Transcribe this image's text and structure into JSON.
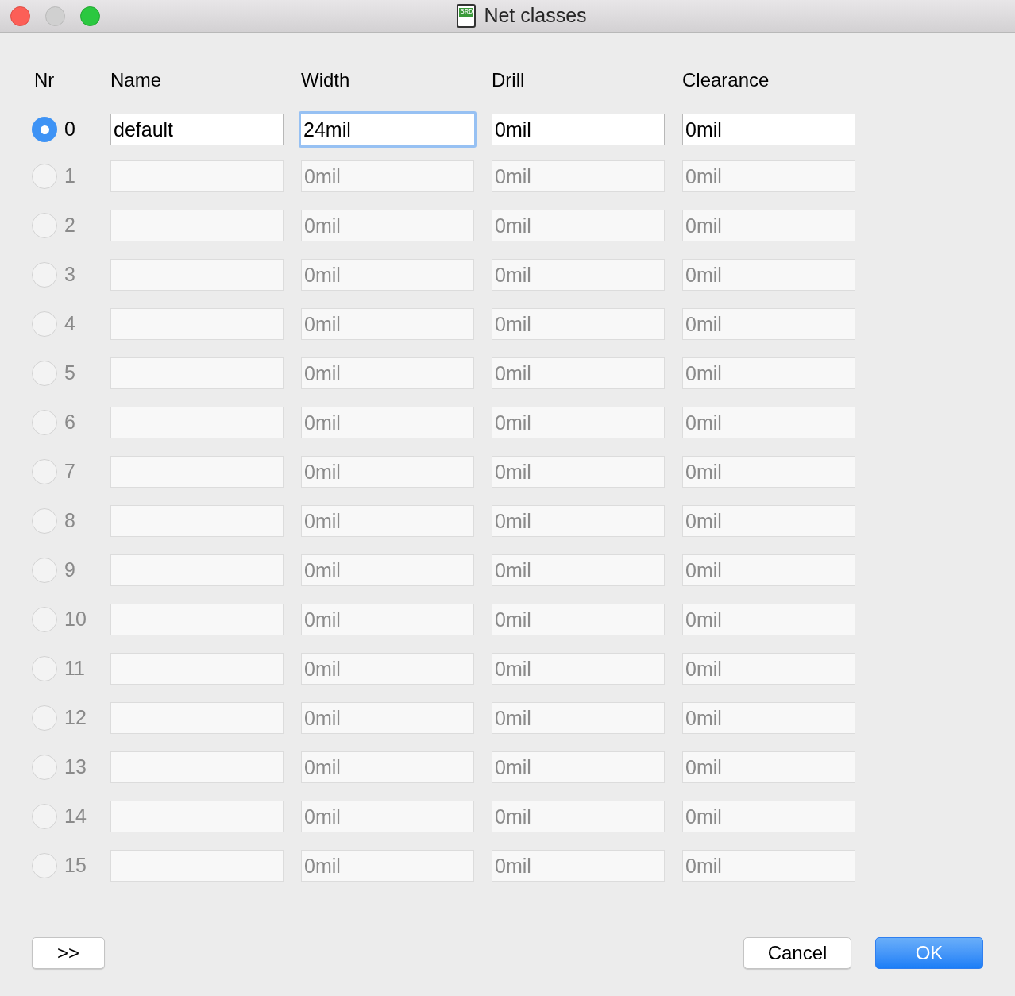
{
  "window": {
    "title": "Net classes",
    "icon_label": "BRD"
  },
  "columns": [
    "Nr",
    "Name",
    "Width",
    "Drill",
    "Clearance"
  ],
  "rows": [
    {
      "nr": "0",
      "selected": true,
      "disabled": false,
      "fields": [
        {
          "value": "default",
          "focused": false
        },
        {
          "value": "24mil",
          "focused": true
        },
        {
          "value": "0mil",
          "focused": false
        },
        {
          "value": "0mil",
          "focused": false
        }
      ]
    },
    {
      "nr": "1",
      "selected": false,
      "disabled": true,
      "fields": [
        {
          "focused": false
        },
        {
          "value": "0mil",
          "focused": false
        },
        {
          "value": "0mil",
          "focused": false
        },
        {
          "value": "0mil",
          "focused": false
        }
      ]
    },
    {
      "nr": "2",
      "selected": false,
      "disabled": true,
      "fields": [
        {
          "focused": false
        },
        {
          "value": "0mil",
          "focused": false
        },
        {
          "value": "0mil",
          "focused": false
        },
        {
          "value": "0mil",
          "focused": false
        }
      ]
    },
    {
      "nr": "3",
      "selected": false,
      "disabled": true,
      "fields": [
        {
          "focused": false
        },
        {
          "value": "0mil",
          "focused": false
        },
        {
          "value": "0mil",
          "focused": false
        },
        {
          "value": "0mil",
          "focused": false
        }
      ]
    },
    {
      "nr": "4",
      "selected": false,
      "disabled": true,
      "fields": [
        {
          "focused": false
        },
        {
          "value": "0mil",
          "focused": false
        },
        {
          "value": "0mil",
          "focused": false
        },
        {
          "value": "0mil",
          "focused": false
        }
      ]
    },
    {
      "nr": "5",
      "selected": false,
      "disabled": true,
      "fields": [
        {
          "focused": false
        },
        {
          "value": "0mil",
          "focused": false
        },
        {
          "value": "0mil",
          "focused": false
        },
        {
          "value": "0mil",
          "focused": false
        }
      ]
    },
    {
      "nr": "6",
      "selected": false,
      "disabled": true,
      "fields": [
        {
          "focused": false
        },
        {
          "value": "0mil",
          "focused": false
        },
        {
          "value": "0mil",
          "focused": false
        },
        {
          "value": "0mil",
          "focused": false
        }
      ]
    },
    {
      "nr": "7",
      "selected": false,
      "disabled": true,
      "fields": [
        {
          "focused": false
        },
        {
          "value": "0mil",
          "focused": false
        },
        {
          "value": "0mil",
          "focused": false
        },
        {
          "value": "0mil",
          "focused": false
        }
      ]
    },
    {
      "nr": "8",
      "selected": false,
      "disabled": true,
      "fields": [
        {
          "focused": false
        },
        {
          "value": "0mil",
          "focused": false
        },
        {
          "value": "0mil",
          "focused": false
        },
        {
          "value": "0mil",
          "focused": false
        }
      ]
    },
    {
      "nr": "9",
      "selected": false,
      "disabled": true,
      "fields": [
        {
          "focused": false
        },
        {
          "value": "0mil",
          "focused": false
        },
        {
          "value": "0mil",
          "focused": false
        },
        {
          "value": "0mil",
          "focused": false
        }
      ]
    },
    {
      "nr": "10",
      "selected": false,
      "disabled": true,
      "fields": [
        {
          "focused": false
        },
        {
          "value": "0mil",
          "focused": false
        },
        {
          "value": "0mil",
          "focused": false
        },
        {
          "value": "0mil",
          "focused": false
        }
      ]
    },
    {
      "nr": "11",
      "selected": false,
      "disabled": true,
      "fields": [
        {
          "focused": false
        },
        {
          "value": "0mil",
          "focused": false
        },
        {
          "value": "0mil",
          "focused": false
        },
        {
          "value": "0mil",
          "focused": false
        }
      ]
    },
    {
      "nr": "12",
      "selected": false,
      "disabled": true,
      "fields": [
        {
          "focused": false
        },
        {
          "value": "0mil",
          "focused": false
        },
        {
          "value": "0mil",
          "focused": false
        },
        {
          "value": "0mil",
          "focused": false
        }
      ]
    },
    {
      "nr": "13",
      "selected": false,
      "disabled": true,
      "fields": [
        {
          "focused": false
        },
        {
          "value": "0mil",
          "focused": false
        },
        {
          "value": "0mil",
          "focused": false
        },
        {
          "value": "0mil",
          "focused": false
        }
      ]
    },
    {
      "nr": "14",
      "selected": false,
      "disabled": true,
      "fields": [
        {
          "focused": false
        },
        {
          "value": "0mil",
          "focused": false
        },
        {
          "value": "0mil",
          "focused": false
        },
        {
          "value": "0mil",
          "focused": false
        }
      ]
    },
    {
      "nr": "15",
      "selected": false,
      "disabled": true,
      "fields": [
        {
          "focused": false
        },
        {
          "value": "0mil",
          "focused": false
        },
        {
          "value": "0mil",
          "focused": false
        },
        {
          "value": "0mil",
          "focused": false
        }
      ]
    }
  ],
  "buttons": [
    {
      "label": ">>",
      "kind": "normal"
    },
    {
      "label": "Cancel",
      "kind": "normal"
    },
    {
      "label": "OK",
      "kind": "default"
    }
  ]
}
